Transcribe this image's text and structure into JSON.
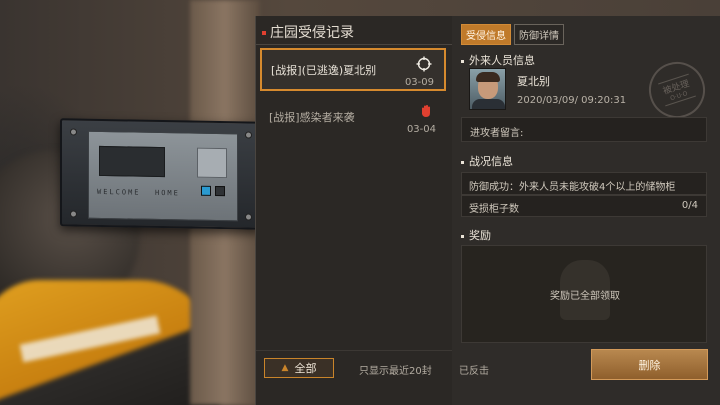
{
  "scene": {
    "panel_label": "WELCOME",
    "panel_label2": "HOME"
  },
  "list": {
    "title": "庄园受侵记录",
    "items": [
      {
        "title": "[战报](已逃逸)夏北别",
        "date": "03-09",
        "icon": "crosshair-icon",
        "selected": true
      },
      {
        "title": "[战报]感染者来袭",
        "date": "03-04",
        "icon": "red-hand-icon",
        "selected": false
      }
    ],
    "all_button": "全部",
    "recent_note": "只显示最近20封",
    "counter_note": "已反击"
  },
  "detail": {
    "tabs": [
      "受侵信息",
      "防御详情"
    ],
    "intruder_section": "外来人员信息",
    "intruder_name": "夏北别",
    "intruder_time": "2020/03/09/ 09:20:31",
    "stamp_text": "被处理",
    "stamp_sub": "O·U·O",
    "message_label": "进攻者留言:",
    "battle_section": "战况信息",
    "battle_result": "防御成功：外来人员未能攻破4个以上的储物柜",
    "damaged_label": "受损柜子数",
    "damaged_value": "0/4",
    "reward_section": "奖励",
    "reward_text": "奖励已全部领取",
    "delete_button": "删除"
  },
  "colors": {
    "accent": "#d68a2e",
    "tab_active": "#c07a2a",
    "alert_red": "#e04030"
  }
}
